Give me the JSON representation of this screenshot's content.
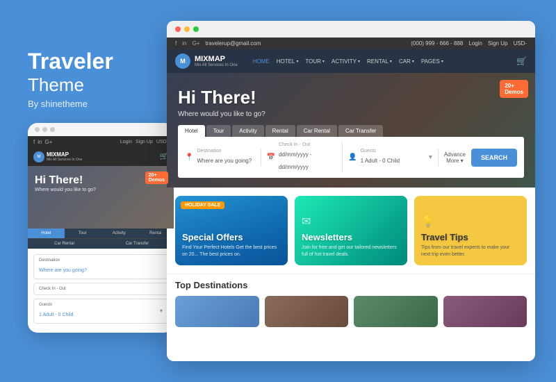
{
  "brand": {
    "name": "Traveler",
    "subtitle": "Theme",
    "by": "By shinetheme"
  },
  "mobile": {
    "dots": [
      "dot1",
      "dot2",
      "dot3"
    ],
    "topbar": {
      "social": [
        "f",
        "in",
        "G+"
      ],
      "login": "Login",
      "signup": "Sign Up",
      "currency": "USD-"
    },
    "navbar": {
      "logo_letter": "M",
      "logo_name": "MIXMAP",
      "logo_sub": "Mix All Services In One",
      "cart_icon": "🛒"
    },
    "hero": {
      "heading": "Hi There!",
      "subheading": "Where would you like to go?",
      "badge": "20+\nDemos"
    },
    "tabs": [
      "Hotel",
      "Tour",
      "Activity",
      "Rental",
      "Car Rental",
      "Car Transfer"
    ],
    "active_tab": "Hotel",
    "form": {
      "destination_label": "Destination",
      "destination_placeholder": "Where are you going?",
      "checkin_label": "Check In - Out",
      "guests_label": "Guests",
      "guests_value": "1 Adult - 0 Child"
    }
  },
  "browser": {
    "dots": [
      "red",
      "yellow",
      "green"
    ],
    "topbar": {
      "social": [
        "f",
        "in",
        "G+"
      ],
      "email": "travelerup@gmail.com",
      "phone": "(000) 999 - 666 - 888",
      "login": "Login",
      "signup": "Sign Up",
      "currency": "USD-"
    },
    "navbar": {
      "logo_letter": "M",
      "logo_name": "MIXMAP",
      "logo_sub": "Mix All Services In One",
      "nav_items": [
        "HOME",
        "HOTEL",
        "TOUR",
        "ACTIVITY",
        "RENTAL",
        "CAR",
        "PAGES"
      ],
      "active_nav": "HOME",
      "cart_icon": "🛒"
    },
    "hero": {
      "heading": "Hi There!",
      "subheading": "Where would you like to go?",
      "badge": "20+\nDemos"
    },
    "search_tabs": [
      "Hotel",
      "Tour",
      "Activity",
      "Rental",
      "Car Rental",
      "Car Transfer"
    ],
    "active_search_tab": "Hotel",
    "search": {
      "destination_label": "Destination",
      "destination_placeholder": "Where are you going?",
      "checkin_label": "Check In - Out",
      "checkin_placeholder": "dd/mm/yyyy - dd/mm/yyyy",
      "guests_label": "Guests",
      "guests_value": "1 Adult - 0 Child",
      "advance_label": "Advance\nMore ▾",
      "search_btn": "SEARCH"
    },
    "cards": [
      {
        "type": "image",
        "badge": "HOLIDAY SALE",
        "title": "Special Offers",
        "desc": "Find Your Perfect Hotels Get the best prices on 20... The best prices on.",
        "icon": ""
      },
      {
        "type": "teal",
        "badge": "",
        "title": "Newsletters",
        "desc": "Join for free and get our tailored newsletters full of hot travel deals.",
        "icon": "✉"
      },
      {
        "type": "yellow",
        "badge": "",
        "title": "Travel Tips",
        "desc": "Tips from our travel experts to make your next trip even better.",
        "icon": "💡"
      }
    ],
    "destinations": {
      "section_title": "Top Destinations",
      "thumbs": [
        "dest1",
        "dest2",
        "dest3",
        "dest4"
      ]
    }
  }
}
